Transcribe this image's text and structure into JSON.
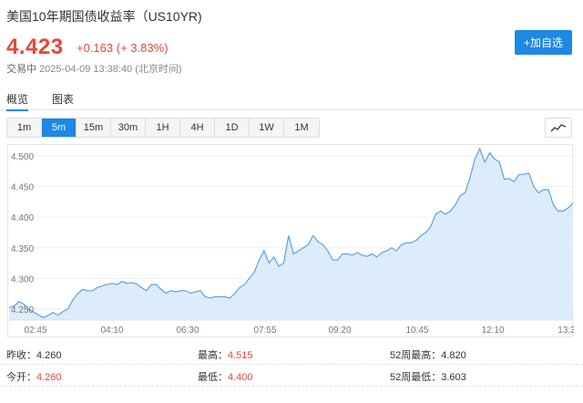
{
  "header": {
    "title": "美国10年期国债收益率（US10YR)",
    "price": "4.423",
    "change": "+0.163 (+ 3.83%)",
    "status_label": "交易中",
    "timestamp": "2025-04-09 13:38:40 (北京时间)",
    "add_favorite_label": "+加自选"
  },
  "tabs": [
    {
      "label": "概览",
      "active": true
    },
    {
      "label": "图表",
      "active": false
    }
  ],
  "intervals": [
    {
      "label": "1m",
      "active": false
    },
    {
      "label": "5m",
      "active": true
    },
    {
      "label": "15m",
      "active": false
    },
    {
      "label": "30m",
      "active": false
    },
    {
      "label": "1H",
      "active": false
    },
    {
      "label": "4H",
      "active": false
    },
    {
      "label": "1D",
      "active": false
    },
    {
      "label": "1W",
      "active": false
    },
    {
      "label": "1M",
      "active": false
    }
  ],
  "chart_toggle_icon": "line-chart-icon",
  "colors": {
    "up": "#e8453c",
    "accent": "#1e88e5",
    "line": "#5aa3e8",
    "fill": "#ddecfb"
  },
  "chart_data": {
    "type": "area",
    "y_ticks": [
      "4.500",
      "4.450",
      "4.400",
      "4.350",
      "4.300",
      "4.250"
    ],
    "x_ticks": [
      "02:45",
      "04:10",
      "06:30",
      "07:55",
      "09:20",
      "10:45",
      "12:10",
      "13:3"
    ],
    "ylim": [
      4.232,
      4.518
    ],
    "values": [
      4.252,
      4.255,
      4.262,
      4.258,
      4.25,
      4.245,
      4.24,
      4.236,
      4.24,
      4.244,
      4.24,
      4.246,
      4.25,
      4.265,
      4.275,
      4.282,
      4.28,
      4.28,
      4.285,
      4.288,
      4.29,
      4.292,
      4.29,
      4.295,
      4.292,
      4.293,
      4.291,
      4.285,
      4.28,
      4.29,
      4.29,
      4.282,
      4.276,
      4.28,
      4.278,
      4.28,
      4.28,
      4.276,
      4.278,
      4.28,
      4.27,
      4.268,
      4.27,
      4.27,
      4.27,
      4.268,
      4.275,
      4.285,
      4.29,
      4.3,
      4.31,
      4.33,
      4.345,
      4.325,
      4.335,
      4.32,
      4.325,
      4.37,
      4.34,
      4.345,
      4.35,
      4.355,
      4.37,
      4.36,
      4.355,
      4.345,
      4.33,
      4.33,
      4.34,
      4.34,
      4.338,
      4.342,
      4.338,
      4.336,
      4.34,
      4.335,
      4.342,
      4.345,
      4.35,
      4.345,
      4.355,
      4.358,
      4.358,
      4.362,
      4.37,
      4.375,
      4.385,
      4.405,
      4.41,
      4.405,
      4.41,
      4.42,
      4.435,
      4.44,
      4.465,
      4.495,
      4.512,
      4.49,
      4.505,
      4.495,
      4.49,
      4.462,
      4.463,
      4.458,
      4.47,
      4.47,
      4.472,
      4.45,
      4.44,
      4.445,
      4.445,
      4.42,
      4.41,
      4.41,
      4.415,
      4.423
    ]
  },
  "stats": [
    [
      {
        "label": "昨收：",
        "value": "4.260",
        "red": false
      },
      {
        "label": "最高：",
        "value": "4.515",
        "red": true
      },
      {
        "label": "52周最高：",
        "value": "4.820",
        "red": false
      }
    ],
    [
      {
        "label": "今开：",
        "value": "4.260",
        "red": true
      },
      {
        "label": "最低：",
        "value": "4.400",
        "red": true
      },
      {
        "label": "52周最低：",
        "value": "3.603",
        "red": false
      }
    ]
  ]
}
